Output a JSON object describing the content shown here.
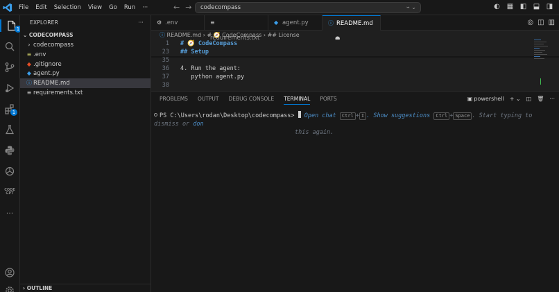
{
  "titlebar": {
    "menus": [
      "File",
      "Edit",
      "Selection",
      "View",
      "Go",
      "Run",
      "···"
    ],
    "search_text": "codecompass"
  },
  "activity": {
    "explorer_badge": "1",
    "extensions_badge": "1",
    "codegpt_label": "CODE GPT"
  },
  "sidebar": {
    "header": "EXPLORER",
    "more": "···",
    "root": "CODECOMPASS",
    "items": [
      {
        "name": "codecompass",
        "icon": "›"
      },
      {
        "name": ".env",
        "icon": "≡"
      },
      {
        "name": ".gitignore",
        "icon": "◆"
      },
      {
        "name": "agent.py",
        "icon": "◆"
      },
      {
        "name": "README.md",
        "icon": "ⓘ"
      },
      {
        "name": "requirements.txt",
        "icon": "≡"
      }
    ],
    "outline": "OUTLINE"
  },
  "tabs": [
    {
      "label": ".env",
      "icon": "⚙"
    },
    {
      "label": "requirements.txt",
      "icon": "≡"
    },
    {
      "label": "agent.py",
      "icon": "◆"
    },
    {
      "label": "README.md",
      "icon": "ⓘ",
      "modified": "●"
    }
  ],
  "breadcrumb": {
    "file": "README.md",
    "part1": "# 🧭 CodeCompass",
    "part2": "## License"
  },
  "editor": {
    "lines": [
      {
        "n": "1",
        "text": "# 🧭 CodeCompass"
      },
      {
        "n": "23",
        "text": "## Setup"
      },
      {
        "n": "35",
        "text": ""
      },
      {
        "n": "36",
        "text": "4. Run the agent:"
      },
      {
        "n": "37",
        "text": "   python agent.py"
      },
      {
        "n": "38",
        "text": ""
      }
    ]
  },
  "panel": {
    "tabs": [
      "PROBLEMS",
      "OUTPUT",
      "DEBUG CONSOLE",
      "TERMINAL",
      "PORTS"
    ],
    "shell": "powershell",
    "prompt": "PS C:\\Users\\rodan\\Desktop\\codecompass>",
    "hint_open_chat": "Open chat",
    "key_ctrl1": "Ctrl",
    "plus": "+",
    "key_i": "I",
    "hint_show_suggestions": ". Show suggestions",
    "key_ctrl2": "Ctrl",
    "key_space": "Space",
    "hint_rest1": ". Start typing to dismiss or",
    "hint_dont": "don",
    "hint_rest2": "this again."
  }
}
